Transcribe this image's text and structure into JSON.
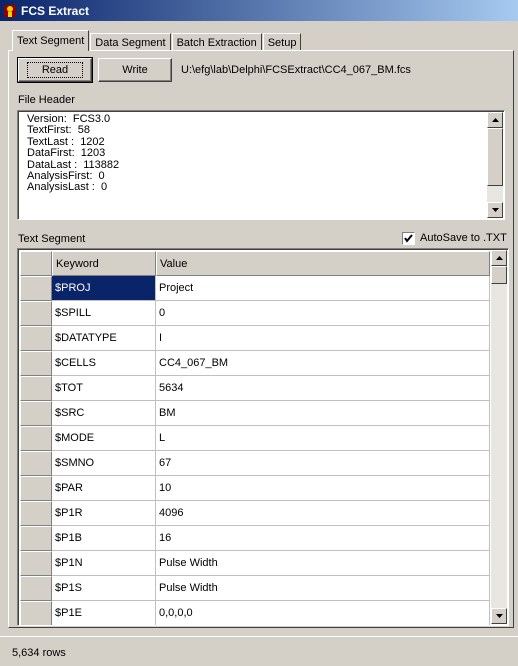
{
  "window": {
    "title": "FCS Extract",
    "icon": "flow-cytometer-icon"
  },
  "tabs": [
    {
      "label": "Text Segment",
      "active": true
    },
    {
      "label": "Data Segment",
      "active": false
    },
    {
      "label": "Batch Extraction",
      "active": false
    },
    {
      "label": "Setup",
      "active": false
    }
  ],
  "toolbar": {
    "read_label": "Read",
    "write_label": "Write",
    "file_path": "U:\\efg\\lab\\Delphi\\FCSExtract\\CC4_067_BM.fcs"
  },
  "file_header": {
    "label": "File Header",
    "lines": [
      "Version:  FCS3.0",
      "TextFirst:  58",
      "TextLast :  1202",
      "DataFirst:  1203",
      "DataLast :  113882",
      "AnalysisFirst:  0",
      "AnalysisLast :  0"
    ]
  },
  "text_segment": {
    "label": "Text Segment",
    "autosave_label": "AutoSave to .TXT",
    "autosave_checked": true,
    "columns": [
      "Keyword",
      "Value"
    ],
    "rows": [
      {
        "keyword": "$PROJ",
        "value": "Project"
      },
      {
        "keyword": "$SPILL",
        "value": "0"
      },
      {
        "keyword": "$DATATYPE",
        "value": "I"
      },
      {
        "keyword": "$CELLS",
        "value": "CC4_067_BM"
      },
      {
        "keyword": "$TOT",
        "value": "5634"
      },
      {
        "keyword": "$SRC",
        "value": "BM"
      },
      {
        "keyword": "$MODE",
        "value": "L"
      },
      {
        "keyword": "$SMNO",
        "value": "67"
      },
      {
        "keyword": "$PAR",
        "value": "10"
      },
      {
        "keyword": "$P1R",
        "value": "4096"
      },
      {
        "keyword": "$P1B",
        "value": "16"
      },
      {
        "keyword": "$P1N",
        "value": "Pulse Width"
      },
      {
        "keyword": "$P1S",
        "value": "Pulse Width"
      },
      {
        "keyword": "$P1E",
        "value": "0,0,0,0"
      }
    ],
    "selected_row": 0
  },
  "status": {
    "rows_text": "5,634 rows"
  },
  "colors": {
    "title_start": "#0a246a",
    "title_end": "#a6caf0",
    "selection": "#0a246a",
    "face": "#d4d0c8"
  }
}
